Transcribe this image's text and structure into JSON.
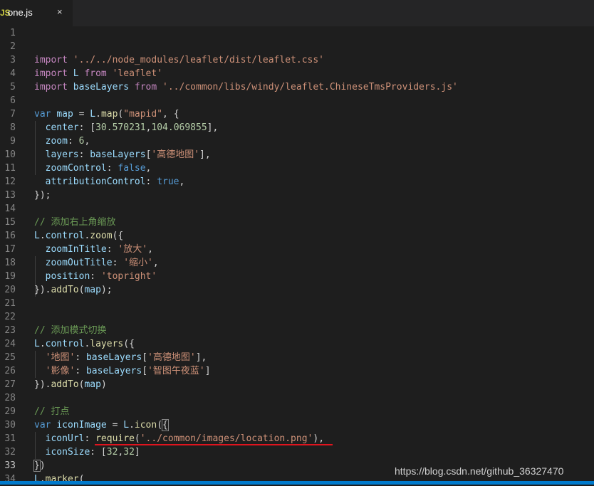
{
  "tab": {
    "icon": "JS",
    "filename": "one.js",
    "close": "×"
  },
  "lines": [
    {
      "n": "1",
      "tokens": []
    },
    {
      "n": "2",
      "tokens": []
    },
    {
      "n": "3",
      "tokens": [
        {
          "t": "import ",
          "c": "k"
        },
        {
          "t": "'../../node_modules/leaflet/dist/leaflet.css'",
          "c": "s"
        }
      ]
    },
    {
      "n": "4",
      "tokens": [
        {
          "t": "import ",
          "c": "k"
        },
        {
          "t": "L ",
          "c": "v"
        },
        {
          "t": "from ",
          "c": "k"
        },
        {
          "t": "'leaflet'",
          "c": "s"
        }
      ]
    },
    {
      "n": "5",
      "tokens": [
        {
          "t": "import ",
          "c": "k"
        },
        {
          "t": "baseLayers ",
          "c": "v"
        },
        {
          "t": "from ",
          "c": "k"
        },
        {
          "t": "'../common/libs/windy/leaflet.ChineseTmsProviders.js'",
          "c": "s"
        }
      ]
    },
    {
      "n": "6",
      "tokens": []
    },
    {
      "n": "7",
      "tokens": [
        {
          "t": "var ",
          "c": "kb"
        },
        {
          "t": "map",
          "c": "v"
        },
        {
          "t": " = ",
          "c": "p"
        },
        {
          "t": "L",
          "c": "v"
        },
        {
          "t": ".",
          "c": "p"
        },
        {
          "t": "map",
          "c": "f"
        },
        {
          "t": "(",
          "c": "p"
        },
        {
          "t": "\"mapid\"",
          "c": "s"
        },
        {
          "t": ", {",
          "c": "p"
        }
      ]
    },
    {
      "n": "8",
      "tokens": [
        {
          "t": "  center",
          "c": "v"
        },
        {
          "t": ": [",
          "c": "p"
        },
        {
          "t": "30.570231",
          "c": "n"
        },
        {
          "t": ",",
          "c": "p"
        },
        {
          "t": "104.069855",
          "c": "n"
        },
        {
          "t": "],",
          "c": "p"
        }
      ]
    },
    {
      "n": "9",
      "tokens": [
        {
          "t": "  zoom",
          "c": "v"
        },
        {
          "t": ": ",
          "c": "p"
        },
        {
          "t": "6",
          "c": "n"
        },
        {
          "t": ",",
          "c": "p"
        }
      ]
    },
    {
      "n": "10",
      "tokens": [
        {
          "t": "  layers",
          "c": "v"
        },
        {
          "t": ": ",
          "c": "p"
        },
        {
          "t": "baseLayers",
          "c": "v"
        },
        {
          "t": "[",
          "c": "p"
        },
        {
          "t": "'高德地图'",
          "c": "s"
        },
        {
          "t": "],",
          "c": "p"
        }
      ]
    },
    {
      "n": "11",
      "tokens": [
        {
          "t": "  zoomControl",
          "c": "v"
        },
        {
          "t": ": ",
          "c": "p"
        },
        {
          "t": "false",
          "c": "kb"
        },
        {
          "t": ",",
          "c": "p"
        }
      ]
    },
    {
      "n": "12",
      "tokens": [
        {
          "t": "  attributionControl",
          "c": "v"
        },
        {
          "t": ": ",
          "c": "p"
        },
        {
          "t": "true",
          "c": "kb"
        },
        {
          "t": ",",
          "c": "p"
        }
      ]
    },
    {
      "n": "13",
      "tokens": [
        {
          "t": "});",
          "c": "p"
        }
      ]
    },
    {
      "n": "14",
      "tokens": []
    },
    {
      "n": "15",
      "tokens": [
        {
          "t": "// 添加右上角缩放",
          "c": "c"
        }
      ]
    },
    {
      "n": "16",
      "tokens": [
        {
          "t": "L",
          "c": "v"
        },
        {
          "t": ".",
          "c": "p"
        },
        {
          "t": "control",
          "c": "v"
        },
        {
          "t": ".",
          "c": "p"
        },
        {
          "t": "zoom",
          "c": "f"
        },
        {
          "t": "({",
          "c": "p"
        }
      ]
    },
    {
      "n": "17",
      "tokens": [
        {
          "t": "  zoomInTitle",
          "c": "v"
        },
        {
          "t": ": ",
          "c": "p"
        },
        {
          "t": "'放大'",
          "c": "s"
        },
        {
          "t": ",",
          "c": "p"
        }
      ]
    },
    {
      "n": "18",
      "tokens": [
        {
          "t": "  zoomOutTitle",
          "c": "v"
        },
        {
          "t": ": ",
          "c": "p"
        },
        {
          "t": "'缩小'",
          "c": "s"
        },
        {
          "t": ",",
          "c": "p"
        }
      ]
    },
    {
      "n": "19",
      "tokens": [
        {
          "t": "  position",
          "c": "v"
        },
        {
          "t": ": ",
          "c": "p"
        },
        {
          "t": "'topright'",
          "c": "s"
        }
      ]
    },
    {
      "n": "20",
      "tokens": [
        {
          "t": "}).",
          "c": "p"
        },
        {
          "t": "addTo",
          "c": "f"
        },
        {
          "t": "(",
          "c": "p"
        },
        {
          "t": "map",
          "c": "v"
        },
        {
          "t": ");",
          "c": "p"
        }
      ]
    },
    {
      "n": "21",
      "tokens": []
    },
    {
      "n": "22",
      "tokens": []
    },
    {
      "n": "23",
      "tokens": [
        {
          "t": "// 添加模式切换",
          "c": "c"
        }
      ]
    },
    {
      "n": "24",
      "tokens": [
        {
          "t": "L",
          "c": "v"
        },
        {
          "t": ".",
          "c": "p"
        },
        {
          "t": "control",
          "c": "v"
        },
        {
          "t": ".",
          "c": "p"
        },
        {
          "t": "layers",
          "c": "f"
        },
        {
          "t": "({",
          "c": "p"
        }
      ]
    },
    {
      "n": "25",
      "tokens": [
        {
          "t": "  ",
          "c": "p"
        },
        {
          "t": "'地图'",
          "c": "s"
        },
        {
          "t": ": ",
          "c": "p"
        },
        {
          "t": "baseLayers",
          "c": "v"
        },
        {
          "t": "[",
          "c": "p"
        },
        {
          "t": "'高德地图'",
          "c": "s"
        },
        {
          "t": "],",
          "c": "p"
        }
      ]
    },
    {
      "n": "26",
      "tokens": [
        {
          "t": "  ",
          "c": "p"
        },
        {
          "t": "'影像'",
          "c": "s"
        },
        {
          "t": ": ",
          "c": "p"
        },
        {
          "t": "baseLayers",
          "c": "v"
        },
        {
          "t": "[",
          "c": "p"
        },
        {
          "t": "'智图午夜蓝'",
          "c": "s"
        },
        {
          "t": "]",
          "c": "p"
        }
      ]
    },
    {
      "n": "27",
      "tokens": [
        {
          "t": "}).",
          "c": "p"
        },
        {
          "t": "addTo",
          "c": "f"
        },
        {
          "t": "(",
          "c": "p"
        },
        {
          "t": "map",
          "c": "v"
        },
        {
          "t": ")",
          "c": "p"
        }
      ]
    },
    {
      "n": "28",
      "tokens": []
    },
    {
      "n": "29",
      "tokens": [
        {
          "t": "// 打点",
          "c": "c"
        }
      ]
    },
    {
      "n": "30",
      "tokens": [
        {
          "t": "var ",
          "c": "kb"
        },
        {
          "t": "iconImage",
          "c": "v"
        },
        {
          "t": " = ",
          "c": "p"
        },
        {
          "t": "L",
          "c": "v"
        },
        {
          "t": ".",
          "c": "p"
        },
        {
          "t": "icon",
          "c": "f"
        },
        {
          "t": "(",
          "c": "p"
        },
        {
          "t": "{",
          "c": "p bracket"
        }
      ]
    },
    {
      "n": "31",
      "tokens": [
        {
          "t": "  iconUrl",
          "c": "v"
        },
        {
          "t": ": ",
          "c": "p"
        },
        {
          "t": "require",
          "c": "f"
        },
        {
          "t": "(",
          "c": "p"
        },
        {
          "t": "'../common/images/location.png'",
          "c": "s"
        },
        {
          "t": "),",
          "c": "p"
        }
      ]
    },
    {
      "n": "32",
      "tokens": [
        {
          "t": "  iconSize",
          "c": "v"
        },
        {
          "t": ": [",
          "c": "p"
        },
        {
          "t": "32",
          "c": "n"
        },
        {
          "t": ",",
          "c": "p"
        },
        {
          "t": "32",
          "c": "n"
        },
        {
          "t": "]",
          "c": "p"
        }
      ]
    },
    {
      "n": "33",
      "tokens": [
        {
          "t": "}",
          "c": "p bracket"
        },
        {
          "t": ")",
          "c": "p"
        }
      ]
    },
    {
      "n": "34",
      "tokens": [
        {
          "t": "L",
          "c": "v"
        },
        {
          "t": ".",
          "c": "p"
        },
        {
          "t": "marker",
          "c": "f"
        },
        {
          "t": "(",
          "c": "p"
        }
      ]
    }
  ],
  "active_line": "33",
  "watermark": "https://blog.csdn.net/github_36327470"
}
